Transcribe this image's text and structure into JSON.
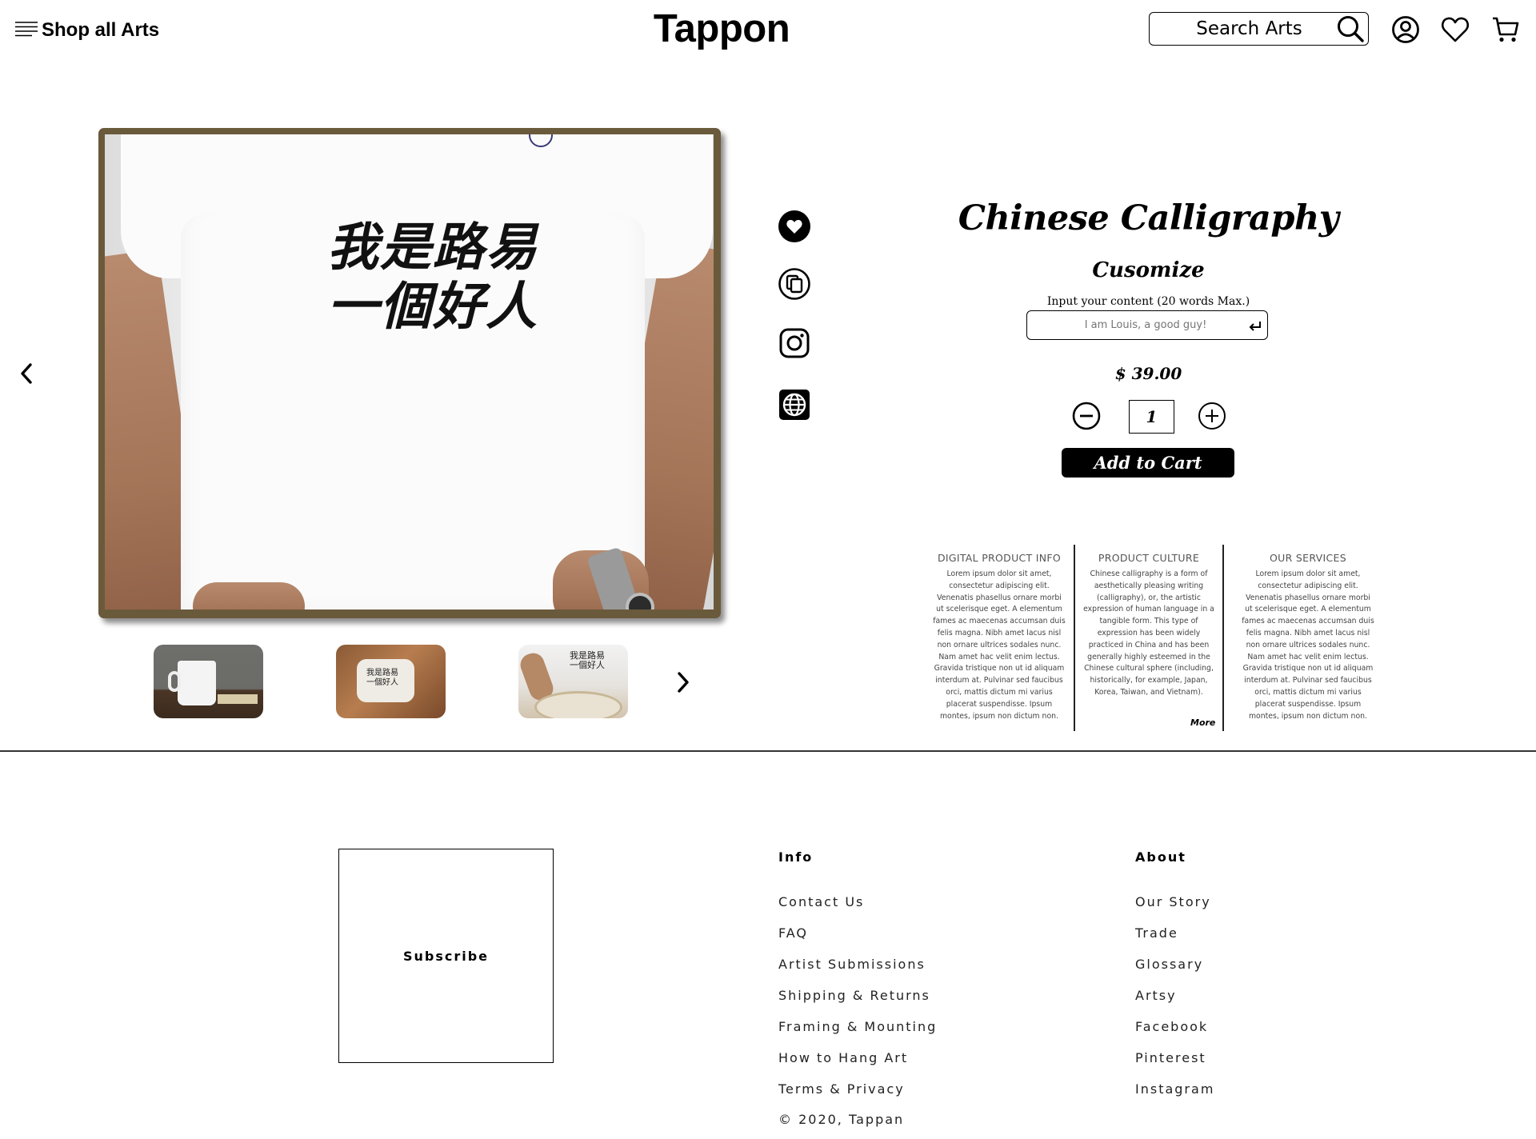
{
  "header": {
    "menu_label": "Shop all Arts",
    "brand": "Tappon",
    "search_placeholder": "Search Arts"
  },
  "product": {
    "title": "Chinese Calligraphy",
    "subtitle": "Cusomize",
    "input_label": "Input your content (20 words Max.)",
    "input_placeholder": "I am Louis, a good guy!",
    "price": "$ 39.00",
    "quantity": "1",
    "add_to_cart": "Add to Cart",
    "calligraphy_line1": "我是路易",
    "calligraphy_line2": "一個好人"
  },
  "thumbnails": [
    {
      "name": "mug"
    },
    {
      "name": "pillow"
    },
    {
      "name": "apron"
    }
  ],
  "social": [
    "heart-icon",
    "copy-icon",
    "instagram-icon",
    "globe-icon"
  ],
  "info_columns": [
    {
      "heading": "DIGITAL PRODUCT INFO",
      "body": "Lorem ipsum dolor sit amet, consectetur adipiscing elit. Venenatis phasellus ornare morbi ut scelerisque eget. A elementum fames ac maecenas accumsan duis felis magna. Nibh amet lacus nisl non ornare ultrices sodales nunc. Nam amet hac velit enim lectus. Gravida tristique non ut id aliquam interdum at. Pulvinar sed faucibus orci, mattis dictum mi varius placerat suspendisse. Ipsum montes, ipsum non dictum non."
    },
    {
      "heading": "PRODUCT CULTURE",
      "body": "Chinese calligraphy is a form of aesthetically pleasing writing (calligraphy), or, the artistic expression of human language in a tangible form. This type of expression has been widely practiced in China and has been generally highly esteemed in the Chinese cultural sphere (including, historically, for example, Japan, Korea, Taiwan, and Vietnam).",
      "more": "More"
    },
    {
      "heading": "OUR SERVICES",
      "body": "Lorem ipsum dolor sit amet, consectetur adipiscing elit. Venenatis phasellus ornare morbi ut scelerisque eget. A elementum fames ac maecenas accumsan duis felis magna. Nibh amet lacus nisl non ornare ultrices sodales nunc. Nam amet hac velit enim lectus. Gravida tristique non ut id aliquam interdum at. Pulvinar sed faucibus orci, mattis dictum mi varius placerat suspendisse. Ipsum montes, ipsum non dictum non."
    }
  ],
  "footer": {
    "subscribe": "Subscribe",
    "info_heading": "Info",
    "info_links": [
      "Contact Us",
      "FAQ",
      "Artist Submissions",
      "Shipping & Returns",
      "Framing & Mounting",
      "How to Hang Art",
      "Terms & Privacy"
    ],
    "about_heading": "About",
    "about_links": [
      "Our Story",
      "Trade",
      "Glossary",
      "Artsy",
      "Facebook",
      "Pinterest",
      "Instagram"
    ],
    "copyright": "© 2020, Tappan"
  },
  "colors": {
    "frame": "#6a5a3c",
    "button_bg": "#000000",
    "text": "#000000"
  }
}
